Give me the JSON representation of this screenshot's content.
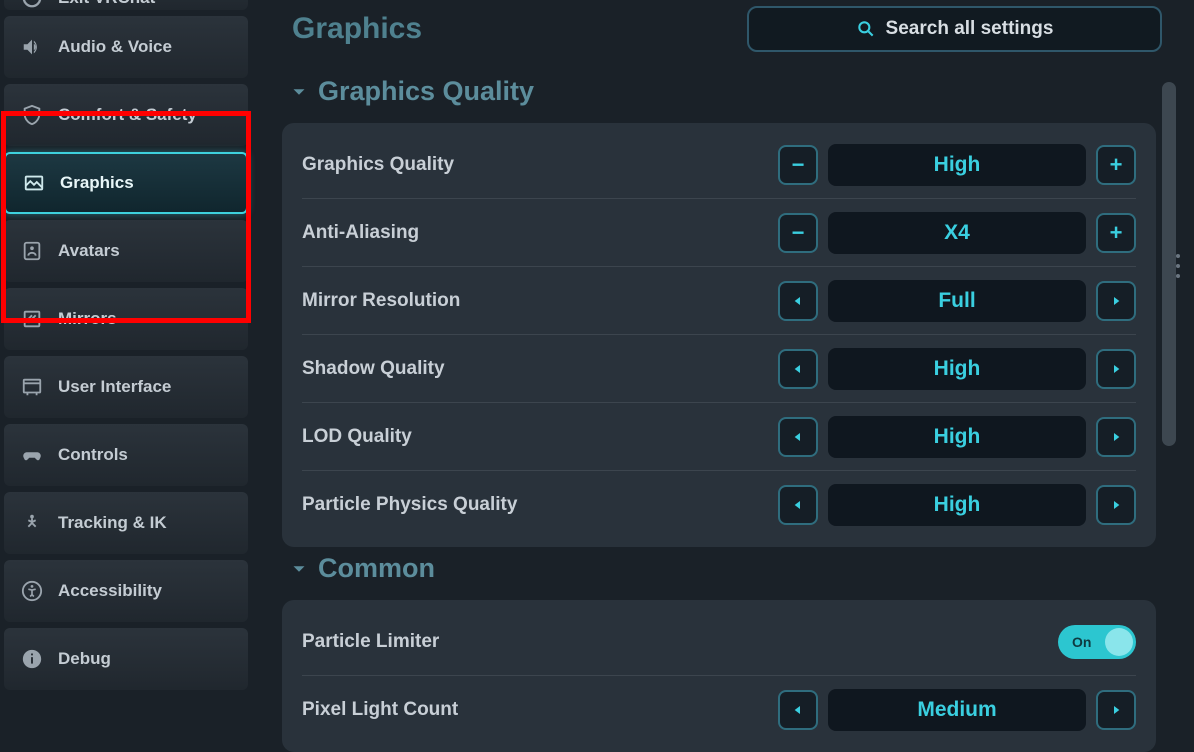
{
  "page_title": "Graphics",
  "search_placeholder": "Search all settings",
  "sidebar": {
    "items": [
      {
        "label": "Exit VRChat",
        "icon": "exit"
      },
      {
        "label": "Audio & Voice",
        "icon": "audio"
      },
      {
        "label": "Comfort & Safety",
        "icon": "shield"
      },
      {
        "label": "Graphics",
        "icon": "image",
        "active": true
      },
      {
        "label": "Avatars",
        "icon": "avatar"
      },
      {
        "label": "Mirrors",
        "icon": "mirror"
      },
      {
        "label": "User Interface",
        "icon": "ui"
      },
      {
        "label": "Controls",
        "icon": "gamepad"
      },
      {
        "label": "Tracking & IK",
        "icon": "tracking"
      },
      {
        "label": "Accessibility",
        "icon": "accessibility"
      },
      {
        "label": "Debug",
        "icon": "info"
      }
    ]
  },
  "sections": [
    {
      "title": "Graphics Quality",
      "settings": [
        {
          "label": "Graphics Quality",
          "value": "High",
          "control": "plusminus"
        },
        {
          "label": "Anti-Aliasing",
          "value": "X4",
          "control": "plusminus"
        },
        {
          "label": "Mirror Resolution",
          "value": "Full",
          "control": "arrows"
        },
        {
          "label": "Shadow Quality",
          "value": "High",
          "control": "arrows"
        },
        {
          "label": "LOD Quality",
          "value": "High",
          "control": "arrows"
        },
        {
          "label": "Particle Physics Quality",
          "value": "High",
          "control": "arrows"
        }
      ]
    },
    {
      "title": "Common",
      "settings": [
        {
          "label": "Particle Limiter",
          "value": "On",
          "control": "toggle"
        },
        {
          "label": "Pixel Light Count",
          "value": "Medium",
          "control": "arrows"
        }
      ]
    }
  ]
}
